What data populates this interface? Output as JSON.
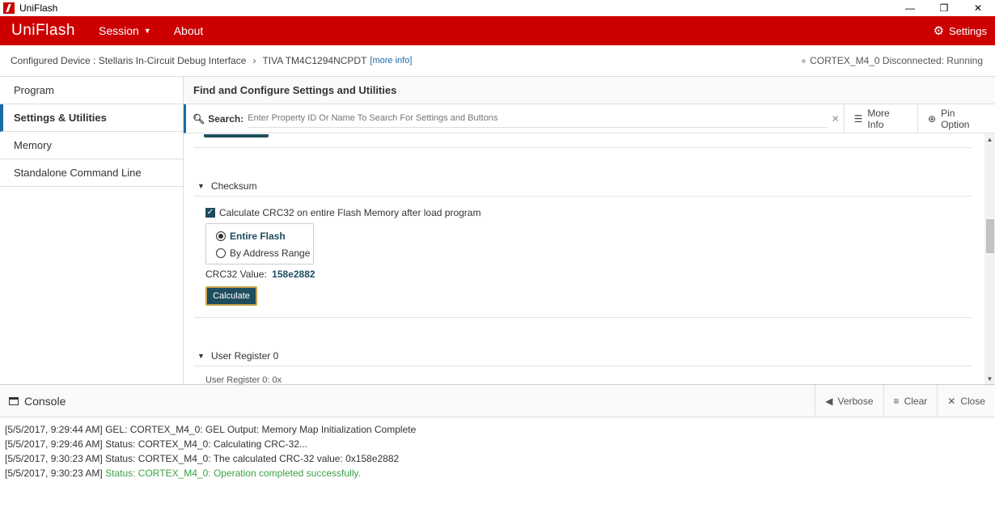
{
  "window": {
    "title": "UniFlash",
    "minimize": "—",
    "maximize": "❐",
    "close": "✕"
  },
  "appbar": {
    "brand": "UniFlash",
    "session": "Session",
    "about": "About",
    "settings": "Settings"
  },
  "device": {
    "prefix": "Configured Device : Stellaris In-Circuit Debug Interface",
    "target": "TIVA TM4C1294NCPDT",
    "more_info": "[more info]",
    "status": "CORTEX_M4_0 Disconnected: Running"
  },
  "sidebar": {
    "items": [
      {
        "label": "Program"
      },
      {
        "label": "Settings & Utilities"
      },
      {
        "label": "Memory"
      },
      {
        "label": "Standalone Command Line"
      }
    ]
  },
  "main": {
    "header": "Find and Configure Settings and Utilities",
    "search_label": "Search:",
    "search_placeholder": "Enter Property ID Or Name To Search For Settings and Buttons",
    "more_info_btn": "More Info",
    "pin_option_btn": "Pin Option"
  },
  "checksum": {
    "title": "Checksum",
    "checkbox_label": "Calculate CRC32 on entire Flash Memory after load program",
    "radio_entire": "Entire Flash",
    "radio_range": "By Address Range",
    "crc_label": "CRC32 Value:",
    "crc_value": "158e2882",
    "calculate_btn": "Calculate"
  },
  "user_register": {
    "title": "User Register 0",
    "cut_text": "User Register 0: 0x"
  },
  "console": {
    "title": "Console",
    "verbose": "Verbose",
    "clear": "Clear",
    "close": "Close",
    "lines": [
      "[5/5/2017, 9:29:44 AM] GEL: CORTEX_M4_0: GEL Output: Memory Map Initialization Complete",
      "[5/5/2017, 9:29:46 AM] Status: CORTEX_M4_0: Calculating CRC-32...",
      "[5/5/2017, 9:30:23 AM] Status: CORTEX_M4_0: The calculated CRC-32 value: 0x158e2882"
    ],
    "last_prefix": "[5/5/2017, 9:30:23 AM]",
    "last_success": "Status: CORTEX_M4_0: Operation completed successfully."
  },
  "colors": {
    "brand_red": "#cc0000",
    "accent_blue": "#1a6aa5",
    "button_teal": "#1e4d5e",
    "success_green": "#3aa145"
  }
}
